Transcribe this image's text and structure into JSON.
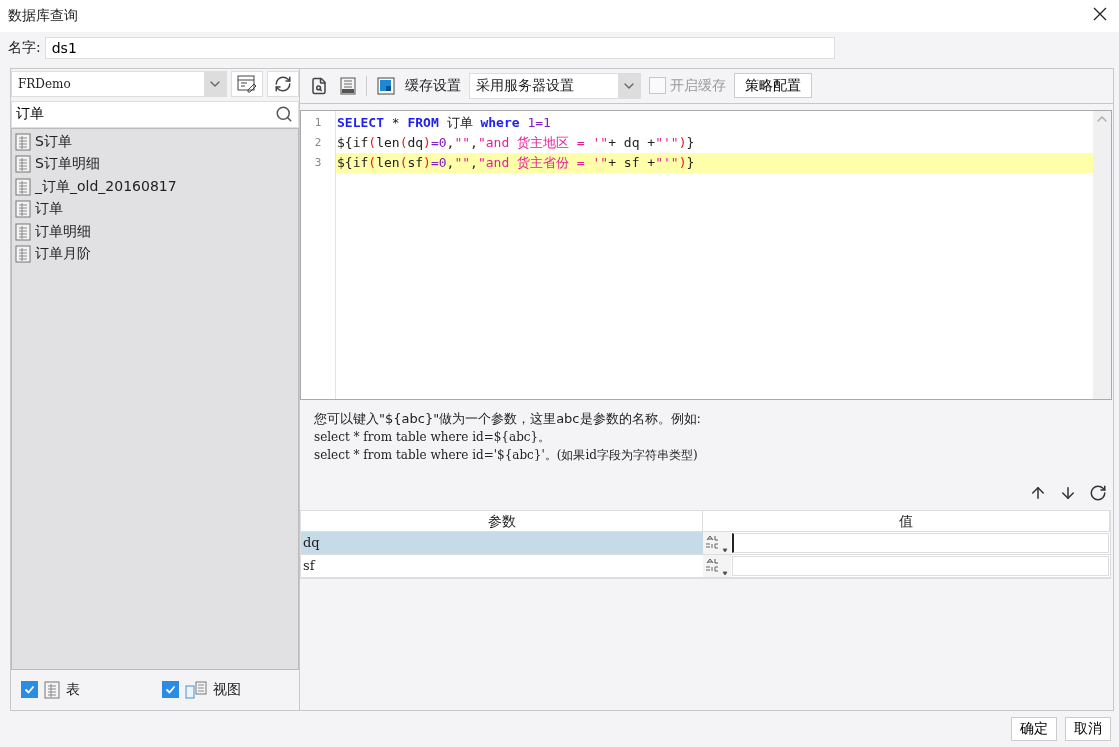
{
  "window": {
    "title": "数据库查询"
  },
  "name_field": {
    "label": "名字:",
    "value": "ds1"
  },
  "datasource": {
    "value": "FRDemo"
  },
  "table_search": {
    "value": "订单"
  },
  "tables": [
    {
      "label": "S订单",
      "selected": false
    },
    {
      "label": "S订单明细",
      "selected": false
    },
    {
      "label": "_订单_old_20160817",
      "selected": false
    },
    {
      "label": "订单",
      "selected": false
    },
    {
      "label": "订单明细",
      "selected": false
    },
    {
      "label": "订单月阶",
      "selected": false
    }
  ],
  "filters": [
    {
      "label": "表",
      "checked": true,
      "kind": "table"
    },
    {
      "label": "视图",
      "checked": true,
      "kind": "view"
    }
  ],
  "toolbar": {
    "cache_label": "缓存设置",
    "cache_mode": "采用服务器设置",
    "enable_cache": {
      "label": "开启缓存",
      "checked": false,
      "disabled": true
    },
    "strategy_button": "策略配置"
  },
  "editor": {
    "lines": [
      {
        "number": "1",
        "selected": false,
        "tokens": [
          {
            "kind": "keyword",
            "text": "SELECT"
          },
          {
            "kind": "plain",
            "text": " * "
          },
          {
            "kind": "keyword",
            "text": "FROM"
          },
          {
            "kind": "plain",
            "text": " 订单 "
          },
          {
            "kind": "keyword",
            "text": "where"
          },
          {
            "kind": "number",
            "text": " 1=1"
          }
        ]
      },
      {
        "number": "2",
        "selected": false,
        "tokens": [
          {
            "kind": "plain",
            "text": "${if"
          },
          {
            "kind": "paren",
            "text": "("
          },
          {
            "kind": "plain",
            "text": "len"
          },
          {
            "kind": "paren",
            "text": "("
          },
          {
            "kind": "plain",
            "text": "dq"
          },
          {
            "kind": "paren",
            "text": ")"
          },
          {
            "kind": "number",
            "text": "=0"
          },
          {
            "kind": "plain",
            "text": ","
          },
          {
            "kind": "string",
            "text": "\"\""
          },
          {
            "kind": "plain",
            "text": ","
          },
          {
            "kind": "string",
            "text": "\"and 货主地区 = '\""
          },
          {
            "kind": "plain",
            "text": "+ dq +"
          },
          {
            "kind": "string",
            "text": "\"'\""
          },
          {
            "kind": "paren",
            "text": ")"
          },
          {
            "kind": "plain",
            "text": "}"
          }
        ]
      },
      {
        "number": "3",
        "selected": true,
        "tokens": [
          {
            "kind": "plain",
            "text": "${if"
          },
          {
            "kind": "paren",
            "text": "("
          },
          {
            "kind": "plain",
            "text": "len"
          },
          {
            "kind": "paren",
            "text": "("
          },
          {
            "kind": "plain",
            "text": "sf"
          },
          {
            "kind": "paren",
            "text": ")"
          },
          {
            "kind": "number",
            "text": "=0"
          },
          {
            "kind": "plain",
            "text": ","
          },
          {
            "kind": "string",
            "text": "\"\""
          },
          {
            "kind": "plain",
            "text": ","
          },
          {
            "kind": "string",
            "text": "\"and 货主省份 = '\""
          },
          {
            "kind": "plain",
            "text": "+ sf +"
          },
          {
            "kind": "string",
            "text": "\"'\""
          },
          {
            "kind": "paren",
            "text": ")"
          },
          {
            "kind": "plain",
            "text": "}"
          }
        ]
      }
    ]
  },
  "hint": [
    "您可以键入\"${abc}\"做为一个参数，这里abc是参数的名称。例如:",
    "select * from table where id=${abc}。",
    "select * from table where id='${abc}'。(如果id字段为字符串类型)"
  ],
  "params": {
    "columns": [
      "参数",
      "值"
    ],
    "rows": [
      {
        "name": "dq",
        "value": "",
        "selected": true
      },
      {
        "name": "sf",
        "value": "",
        "selected": false
      }
    ]
  },
  "buttons": [
    "确定",
    "取消"
  ]
}
